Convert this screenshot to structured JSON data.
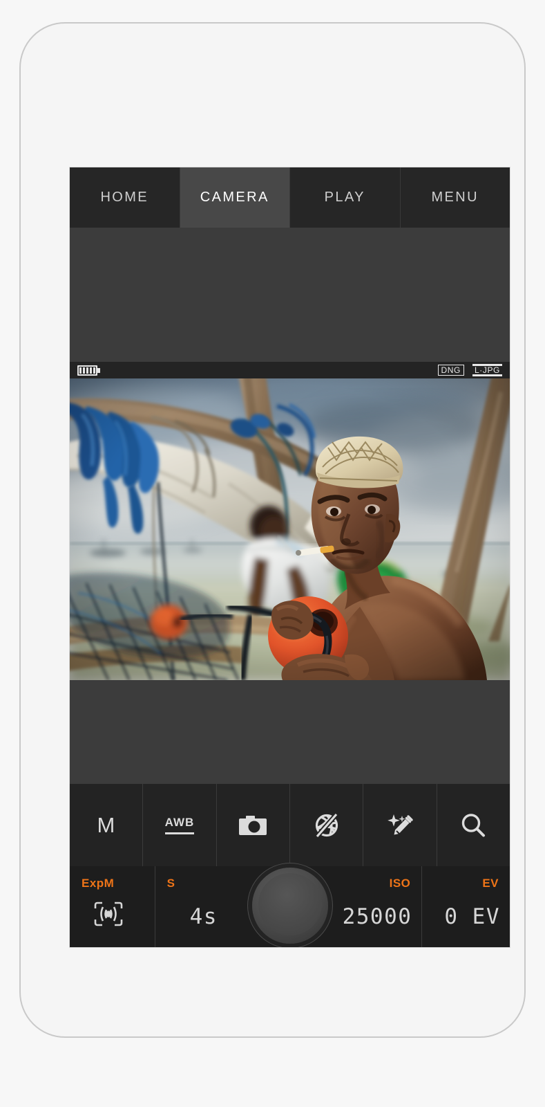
{
  "device": {
    "label": "smartphone-mockup",
    "side_button": "power-button"
  },
  "app": {
    "name": "Camera",
    "accent_color": "#ee7418",
    "chrome_color": "#262626",
    "screen_background": "#3c3c3c"
  },
  "tabs": [
    {
      "label": "HOME",
      "name": "tab-home",
      "active": false
    },
    {
      "label": "CAMERA",
      "name": "tab-camera",
      "active": true
    },
    {
      "label": "PLAY",
      "name": "tab-play",
      "active": false
    },
    {
      "label": "MENU",
      "name": "tab-menu",
      "active": false
    }
  ],
  "status_bar": {
    "battery_icon": "battery-icon",
    "battery_bars": 5,
    "formats": [
      {
        "label": "DNG",
        "style": "boxed",
        "name": "format-badge-dng"
      },
      {
        "label": "L·JPG",
        "style": "lined",
        "name": "format-badge-jpg"
      }
    ]
  },
  "preview": {
    "alt": "Fisherman in embroidered kofia cap holding an orange net float beside a dhow"
  },
  "toolbar": [
    {
      "name": "tool-exposure-mode",
      "icon": "letter-m-icon",
      "label": "M"
    },
    {
      "name": "tool-white-balance",
      "icon": "awb-icon",
      "label": "AWB"
    },
    {
      "name": "tool-drive-mode",
      "icon": "single-shot-icon",
      "label": ""
    },
    {
      "name": "tool-flash-off",
      "icon": "flash-off-icon",
      "label": ""
    },
    {
      "name": "tool-auto-enhance",
      "icon": "magic-eyedropper-icon",
      "label": ""
    },
    {
      "name": "tool-zoom",
      "icon": "magnifier-icon",
      "label": ""
    }
  ],
  "parameters": {
    "exposure_mode": {
      "tag": "ExpM",
      "icon": "spot-metering-icon",
      "value": ""
    },
    "shutter": {
      "tag": "S",
      "value": "4s"
    },
    "iso": {
      "tag": "ISO",
      "value": "25000"
    },
    "exposure_comp": {
      "tag": "EV",
      "value": "0 EV"
    },
    "shutter_button": "shutter-release-button"
  }
}
